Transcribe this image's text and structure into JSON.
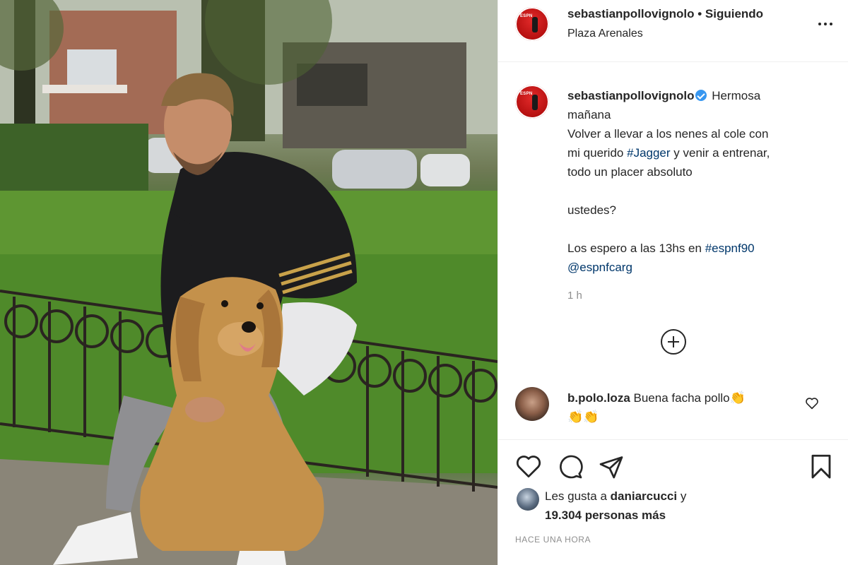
{
  "post": {
    "username": "sebastianpollovignolo",
    "follow_status": "Siguiendo",
    "separator": "•",
    "location": "Plaza Arenales",
    "avatar_text": "ESPN"
  },
  "caption": {
    "username": "sebastianpollovignolo",
    "line1": "Hermosa",
    "line2": "mañana",
    "line3": "Volver a llevar a los nenes al cole con",
    "line4_pre": "mi querido ",
    "line4_tag": "#Jagger",
    "line4_post": " y venir a entrenar,",
    "line5": "todo un placer absoluto",
    "line6": "ustedes?",
    "line7_pre": "Los espero a las 13hs en ",
    "line7_tag": "#espnf90",
    "line8_mention": "@espnfcarg",
    "time": "1 h"
  },
  "comment": {
    "username": "b.polo.loza",
    "text": "Buena facha pollo",
    "emoji": "👏"
  },
  "likes": {
    "prefix": "Les gusta a ",
    "liker": "daniarcucci",
    "mid": " y",
    "count_text": "19.304 personas más"
  },
  "posted_ago": "HACE UNA HORA",
  "icons": [
    "more-icon",
    "verified-icon",
    "add-comment-icon",
    "heart-icon",
    "comment-icon",
    "share-icon",
    "bookmark-icon"
  ],
  "colors": {
    "link": "#00376b",
    "verified": "#3897f0",
    "muted": "#8e8e8e",
    "text": "#262626"
  }
}
